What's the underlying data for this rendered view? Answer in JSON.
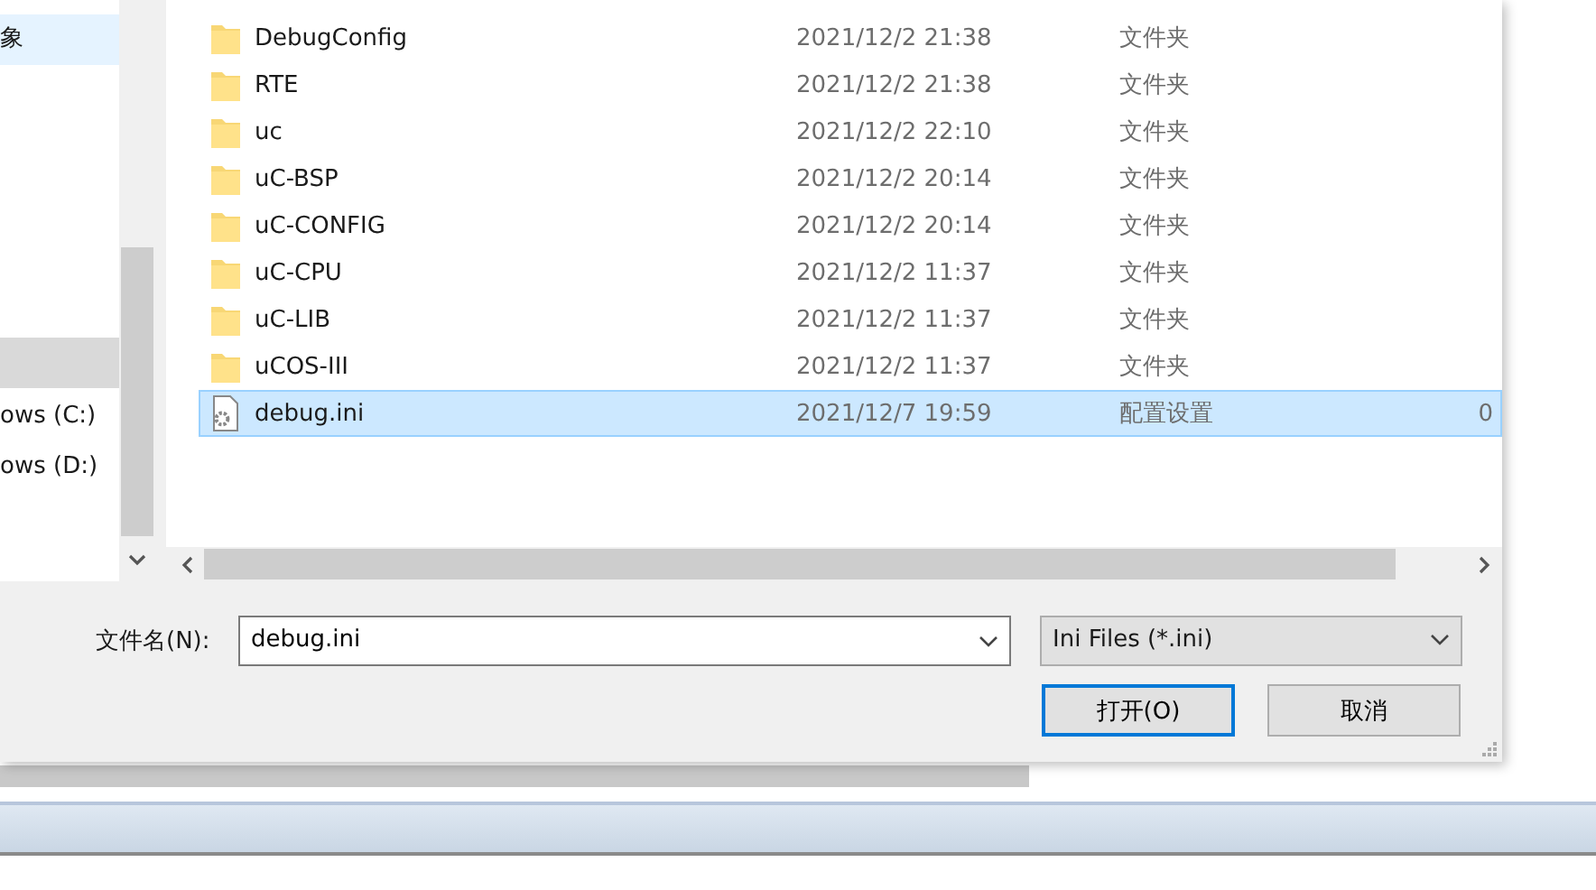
{
  "navigation": {
    "items": [
      {
        "kind": "item",
        "label": "象",
        "selected": true
      },
      {
        "kind": "group"
      },
      {
        "kind": "item",
        "label": "ows (C:)",
        "selected": false
      },
      {
        "kind": "item",
        "label": "ows (D:)",
        "selected": false
      }
    ]
  },
  "files": [
    {
      "kind": "folder",
      "name": "DebugConfig",
      "date": "2021/12/2 21:38",
      "type": "文件夹",
      "selected": false
    },
    {
      "kind": "folder",
      "name": "RTE",
      "date": "2021/12/2 21:38",
      "type": "文件夹",
      "selected": false
    },
    {
      "kind": "folder",
      "name": "uc",
      "date": "2021/12/2 22:10",
      "type": "文件夹",
      "selected": false
    },
    {
      "kind": "folder",
      "name": "uC-BSP",
      "date": "2021/12/2 20:14",
      "type": "文件夹",
      "selected": false
    },
    {
      "kind": "folder",
      "name": "uC-CONFIG",
      "date": "2021/12/2 20:14",
      "type": "文件夹",
      "selected": false
    },
    {
      "kind": "folder",
      "name": "uC-CPU",
      "date": "2021/12/2 11:37",
      "type": "文件夹",
      "selected": false
    },
    {
      "kind": "folder",
      "name": "uC-LIB",
      "date": "2021/12/2 11:37",
      "type": "文件夹",
      "selected": false
    },
    {
      "kind": "folder",
      "name": "uCOS-III",
      "date": "2021/12/2 11:37",
      "type": "文件夹",
      "selected": false
    },
    {
      "kind": "settings-file",
      "name": "debug.ini",
      "date": "2021/12/7 19:59",
      "type": "配置设置",
      "size": "0",
      "selected": true
    }
  ],
  "filename": {
    "label": "文件名(N):",
    "value": "debug.ini"
  },
  "file_type": {
    "value": "Ini Files (*.ini)"
  },
  "buttons": [
    {
      "label": "打开(O)",
      "default": true
    },
    {
      "label": "取消",
      "default": false
    }
  ]
}
